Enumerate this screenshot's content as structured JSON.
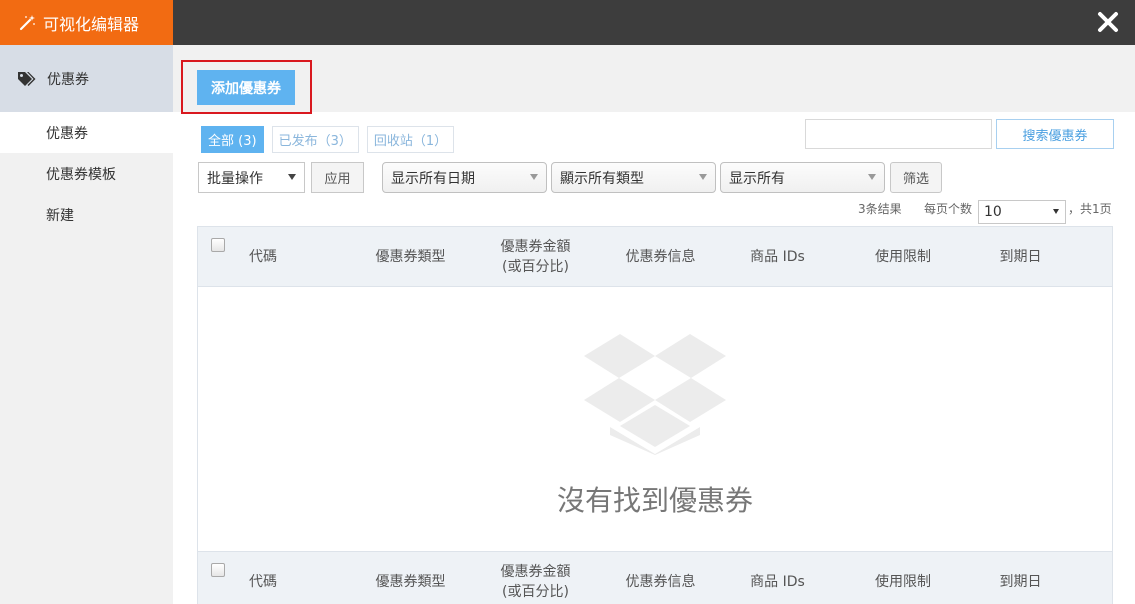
{
  "app": {
    "title": "可视化编辑器"
  },
  "sidebar": {
    "section_title": "优惠券",
    "items": [
      {
        "label": "优惠券"
      },
      {
        "label": "优惠券模板"
      },
      {
        "label": "新建"
      }
    ]
  },
  "toolbar": {
    "add_label": "添加優惠券"
  },
  "filters": {
    "tabs": [
      {
        "label": "全部 (3)"
      },
      {
        "label": "已发布（3）"
      },
      {
        "label": "回收站（1）"
      }
    ],
    "search_value": "",
    "search_button": "搜索優惠券",
    "bulk_action": "批量操作",
    "apply_button": "应用",
    "date_filter": "显示所有日期",
    "type_filter": "顯示所有類型",
    "show_filter": "显示所有",
    "filter_button": "筛选"
  },
  "pagination": {
    "result_count": "3条结果",
    "per_page_label": "每页个数",
    "per_page_value": "10",
    "total_pages": "，共1页"
  },
  "table": {
    "columns": [
      "代碼",
      "優惠券類型",
      "優惠券金額\n(或百分比)",
      "优惠券信息",
      "商品 IDs",
      "使用限制",
      "到期日"
    ],
    "empty_message": "沒有找到優惠券"
  },
  "colors": {
    "brand": "#f26b12",
    "accent": "#5fb3f0",
    "topbar": "#3d3d3d",
    "highlight": "#d9181f"
  },
  "icons": {
    "brand": "magic-wand-icon",
    "close": "close-icon",
    "section": "tags-icon",
    "empty": "empty-box-icon"
  }
}
